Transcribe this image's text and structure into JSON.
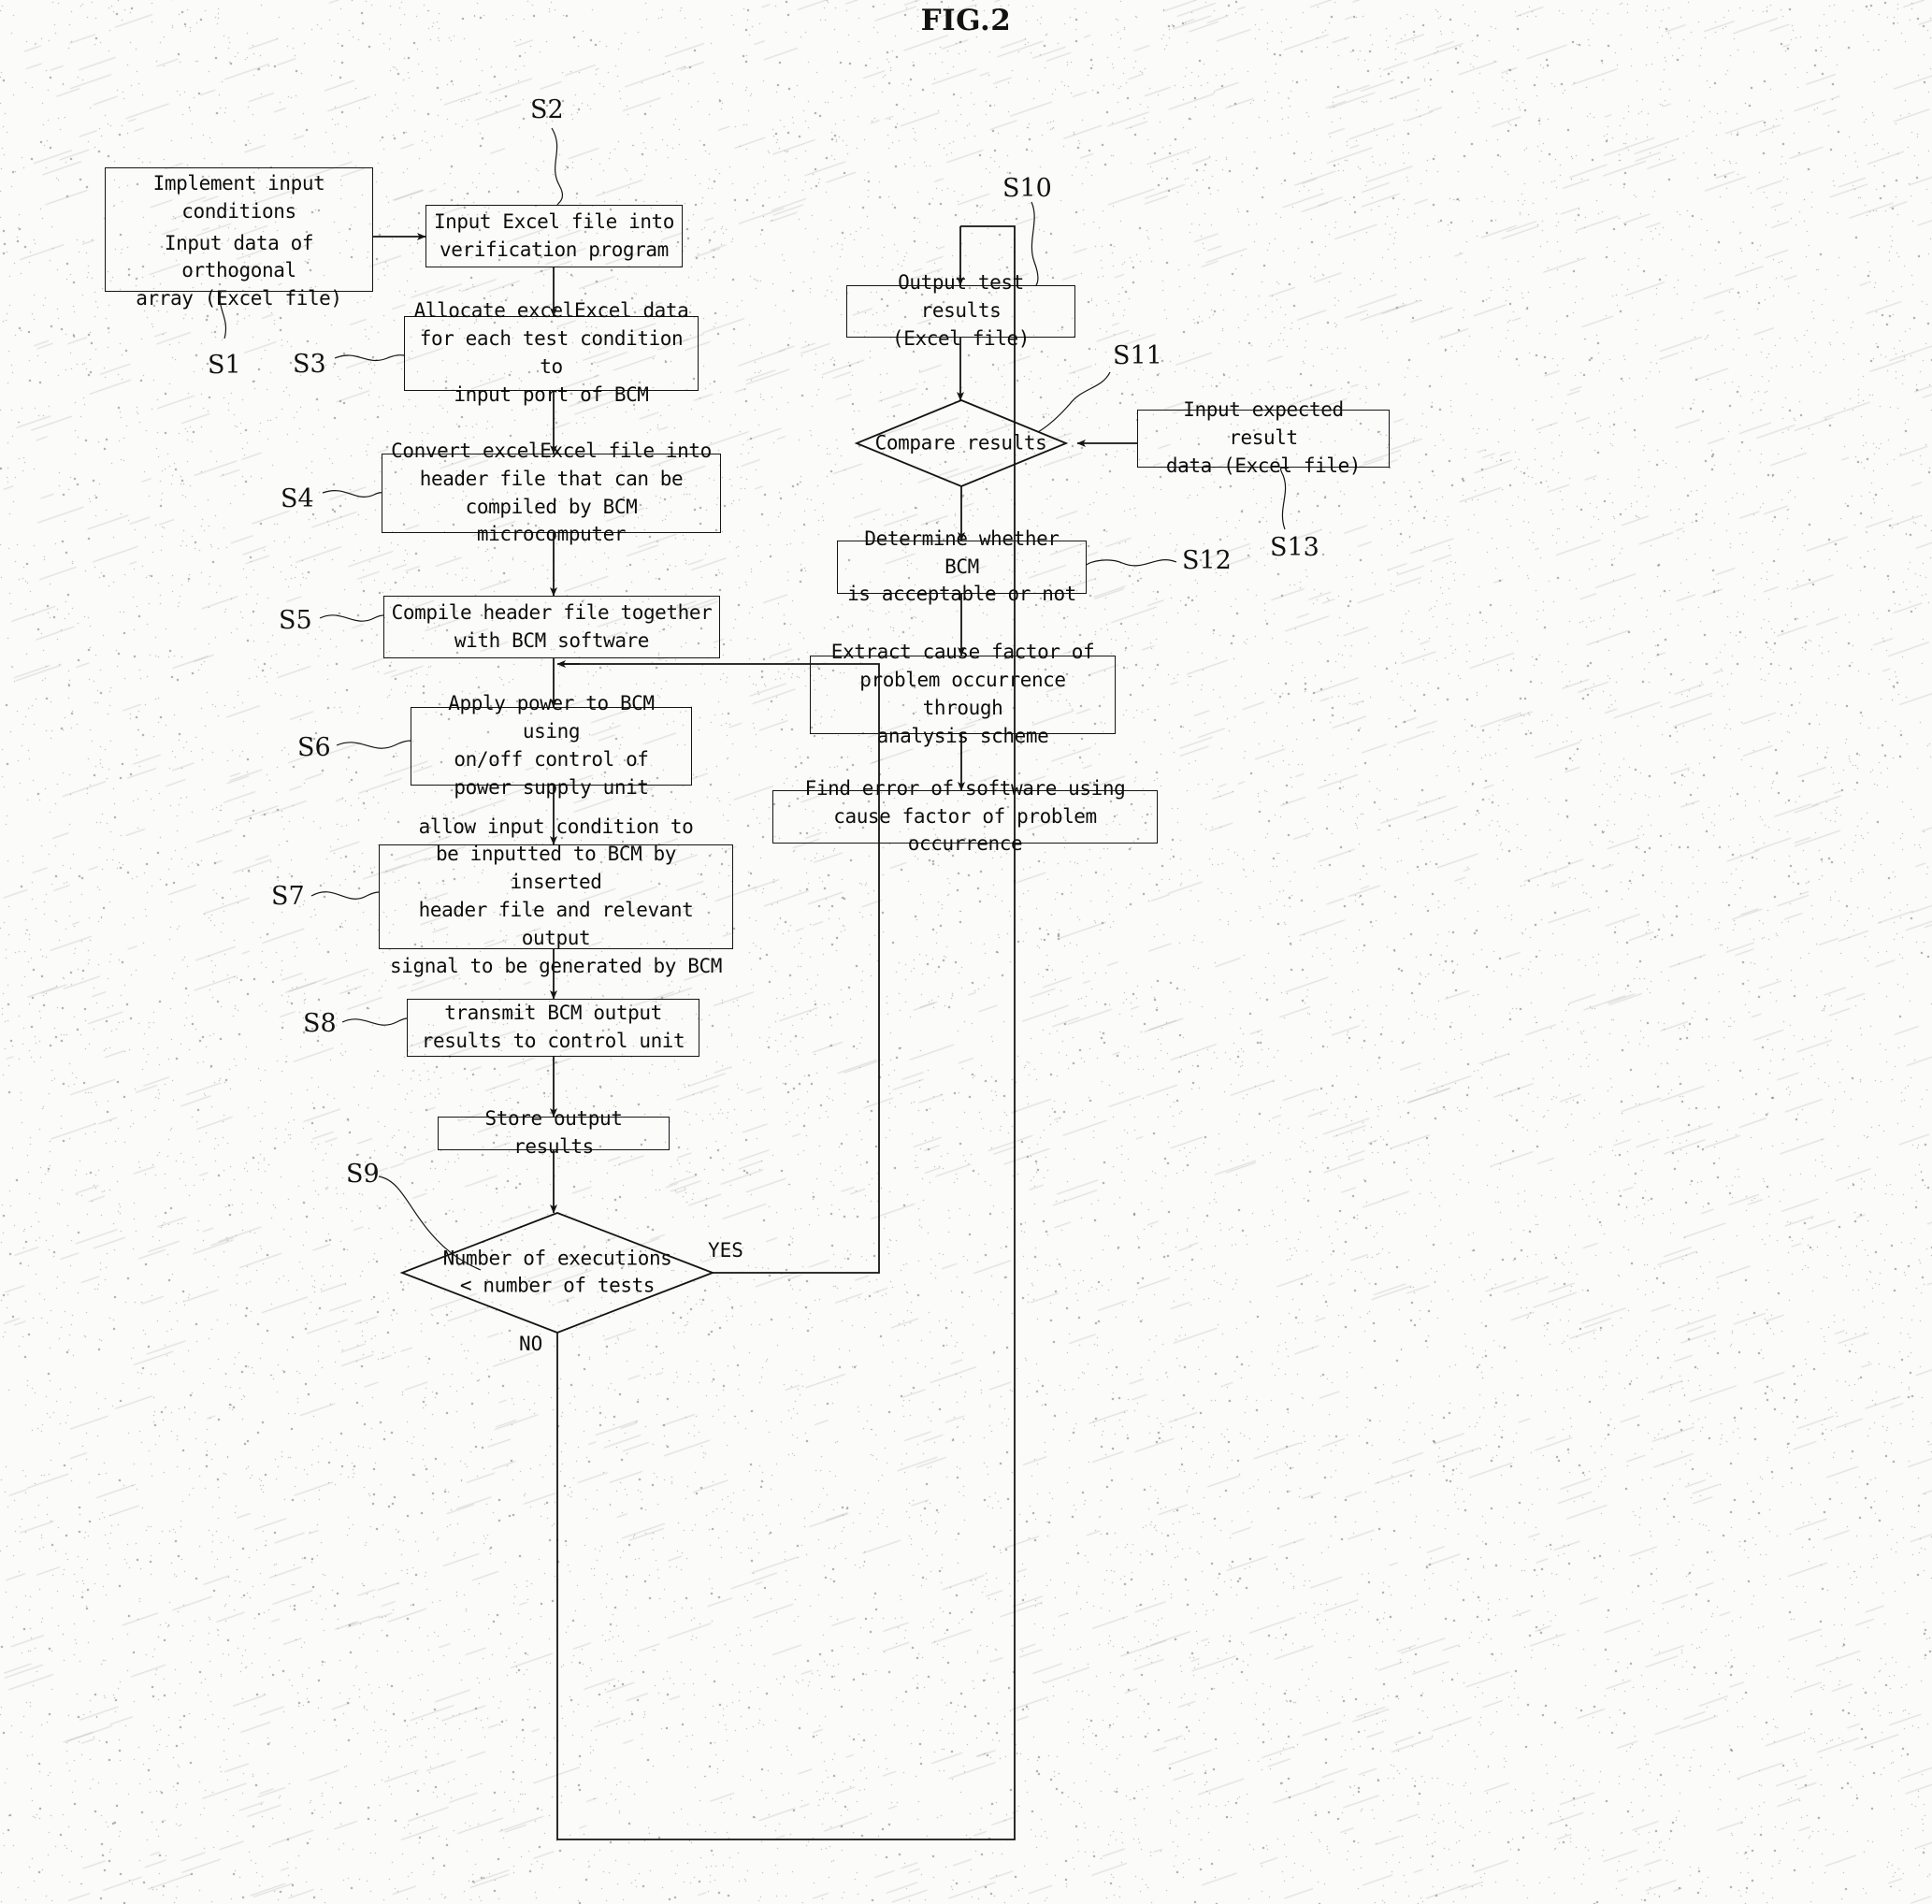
{
  "figure": {
    "title": "FIG.2"
  },
  "boxes": {
    "s1": {
      "line_a": "Implement input\nconditions",
      "line_b": "Input data of orthogonal\narray (Excel file)"
    },
    "s2": {
      "text": "Input Excel file into\nverification program"
    },
    "s3": {
      "text": "Allocate excelExcel data\nfor each test condition to\ninput port of BCM"
    },
    "s4": {
      "text": "Convert excelExcel file into\nheader file that can be\ncompiled by BCM microcomputer"
    },
    "s5": {
      "text": "Compile header file together\nwith BCM software"
    },
    "s6": {
      "text": "Apply power to BCM using\non/off control of\npower supply unit"
    },
    "s7": {
      "text": "allow input condition to\nbe inputted to BCM by inserted\nheader file and relevant output\nsignal to be generated by BCM"
    },
    "s8": {
      "text": "transmit BCM output\nresults to control unit"
    },
    "store": {
      "text": "Store output results"
    },
    "s10": {
      "text": "Output test results\n(Excel file)"
    },
    "s13": {
      "text": "Input expected result\ndata (Excel file)"
    },
    "s12": {
      "text": "Determine whether BCM\nis acceptable or not"
    },
    "extract": {
      "text": "Extract cause factor of\nproblem occurrence through\nanalysis scheme"
    },
    "find": {
      "text": "Find error of software using\ncause factor of problem occurrence"
    }
  },
  "diamonds": {
    "s9": {
      "text": "Number of executions\n< number of tests"
    },
    "s11": {
      "text": "Compare results"
    }
  },
  "step_labels": {
    "s1": "S1",
    "s2": "S2",
    "s3": "S3",
    "s4": "S4",
    "s5": "S5",
    "s6": "S6",
    "s7": "S7",
    "s8": "S8",
    "s9": "S9",
    "s10": "S10",
    "s11": "S11",
    "s12": "S12",
    "s13": "S13"
  },
  "edge_labels": {
    "yes": "YES",
    "no": "NO"
  },
  "colors": {
    "ink": "#111111",
    "paper": "#fbfbfa"
  }
}
